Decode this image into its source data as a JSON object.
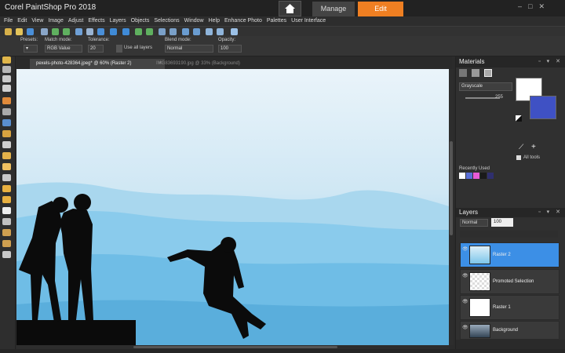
{
  "app": {
    "title": "Corel PaintShop Pro 2018"
  },
  "workspace_tabs": {
    "manage": "Manage",
    "edit": "Edit"
  },
  "menu": [
    "File",
    "Edit",
    "View",
    "Image",
    "Adjust",
    "Effects",
    "Layers",
    "Objects",
    "Selections",
    "Window",
    "Help",
    "Enhance Photo",
    "Palettes",
    "User Interface"
  ],
  "options": {
    "presets_label": "Presets:",
    "match_mode_label": "Match mode:",
    "match_mode_value": "RGB Value",
    "tolerance_label": "Tolerance:",
    "tolerance_value": "20",
    "use_all_layers": "Use all layers",
    "blend_mode_label": "Blend mode:",
    "blend_mode_value": "Normal",
    "opacity_label": "Opacity:",
    "opacity_value": "100"
  },
  "documents": {
    "active": "pexels-photo-428364.jpeg* @ 60% (Raster 2)",
    "inactive": "IMG83693190.jpg @ 33% (Background)",
    "close": "×"
  },
  "materials": {
    "title": "Materials",
    "mode": "Grayscale",
    "value_255": "255",
    "all_tools": "All tools",
    "recently_used": "Recently Used",
    "swatches": [
      "#ffffff",
      "#5a6fd6",
      "#e85bd6",
      "#1a1a1a",
      "#2f2f6e",
      "#3a3a3a"
    ]
  },
  "layers": {
    "title": "Layers",
    "blend": "Normal",
    "opacity": "100",
    "items": [
      {
        "name": "Raster 2"
      },
      {
        "name": "Promoted Selection"
      },
      {
        "name": "Raster 1"
      },
      {
        "name": "Background"
      }
    ]
  },
  "colors": {
    "accent": "#ef7f22",
    "selection": "#3c8fe6"
  }
}
